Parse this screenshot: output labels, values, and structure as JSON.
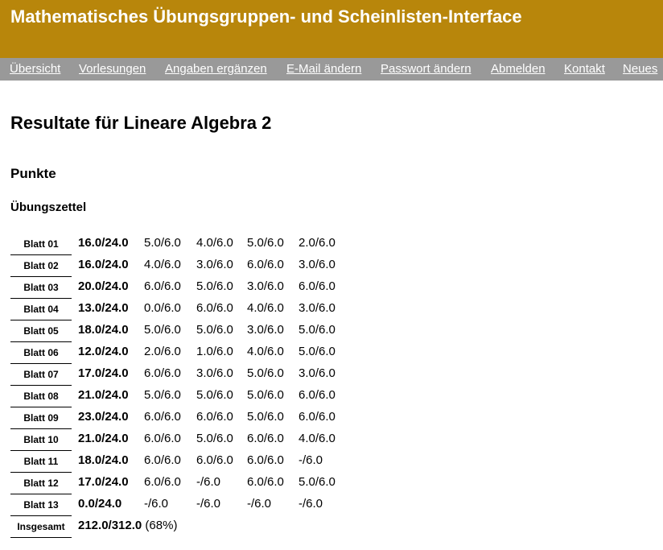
{
  "header": {
    "title": "Mathematisches Übungsgruppen- und Scheinlisten-Interface"
  },
  "nav": {
    "items": [
      "Übersicht",
      "Vorlesungen",
      "Angaben ergänzen",
      "E-Mail ändern",
      "Passwort ändern",
      "Abmelden",
      "Kontakt",
      "Neues"
    ]
  },
  "page": {
    "title": "Resultate für Lineare Algebra 2",
    "section": "Punkte",
    "subsection": "Übungszettel"
  },
  "results": {
    "rows": [
      {
        "label": "Blatt 01",
        "total": "16.0/24.0",
        "scores": [
          "5.0/6.0",
          "4.0/6.0",
          "5.0/6.0",
          "2.0/6.0"
        ]
      },
      {
        "label": "Blatt 02",
        "total": "16.0/24.0",
        "scores": [
          "4.0/6.0",
          "3.0/6.0",
          "6.0/6.0",
          "3.0/6.0"
        ]
      },
      {
        "label": "Blatt 03",
        "total": "20.0/24.0",
        "scores": [
          "6.0/6.0",
          "5.0/6.0",
          "3.0/6.0",
          "6.0/6.0"
        ]
      },
      {
        "label": "Blatt 04",
        "total": "13.0/24.0",
        "scores": [
          "0.0/6.0",
          "6.0/6.0",
          "4.0/6.0",
          "3.0/6.0"
        ]
      },
      {
        "label": "Blatt 05",
        "total": "18.0/24.0",
        "scores": [
          "5.0/6.0",
          "5.0/6.0",
          "3.0/6.0",
          "5.0/6.0"
        ]
      },
      {
        "label": "Blatt 06",
        "total": "12.0/24.0",
        "scores": [
          "2.0/6.0",
          "1.0/6.0",
          "4.0/6.0",
          "5.0/6.0"
        ]
      },
      {
        "label": "Blatt 07",
        "total": "17.0/24.0",
        "scores": [
          "6.0/6.0",
          "3.0/6.0",
          "5.0/6.0",
          "3.0/6.0"
        ]
      },
      {
        "label": "Blatt 08",
        "total": "21.0/24.0",
        "scores": [
          "5.0/6.0",
          "5.0/6.0",
          "5.0/6.0",
          "6.0/6.0"
        ]
      },
      {
        "label": "Blatt 09",
        "total": "23.0/24.0",
        "scores": [
          "6.0/6.0",
          "6.0/6.0",
          "5.0/6.0",
          "6.0/6.0"
        ]
      },
      {
        "label": "Blatt 10",
        "total": "21.0/24.0",
        "scores": [
          "6.0/6.0",
          "5.0/6.0",
          "6.0/6.0",
          "4.0/6.0"
        ]
      },
      {
        "label": "Blatt 11",
        "total": "18.0/24.0",
        "scores": [
          "6.0/6.0",
          "6.0/6.0",
          "6.0/6.0",
          "-/6.0"
        ]
      },
      {
        "label": "Blatt 12",
        "total": "17.0/24.0",
        "scores": [
          "6.0/6.0",
          "-/6.0",
          "6.0/6.0",
          "5.0/6.0"
        ]
      },
      {
        "label": "Blatt 13",
        "total": "0.0/24.0",
        "scores": [
          "-/6.0",
          "-/6.0",
          "-/6.0",
          "-/6.0"
        ]
      }
    ],
    "summary": {
      "label": "Insgesamt",
      "total": "212.0/312.0",
      "percent": "(68%)"
    }
  }
}
